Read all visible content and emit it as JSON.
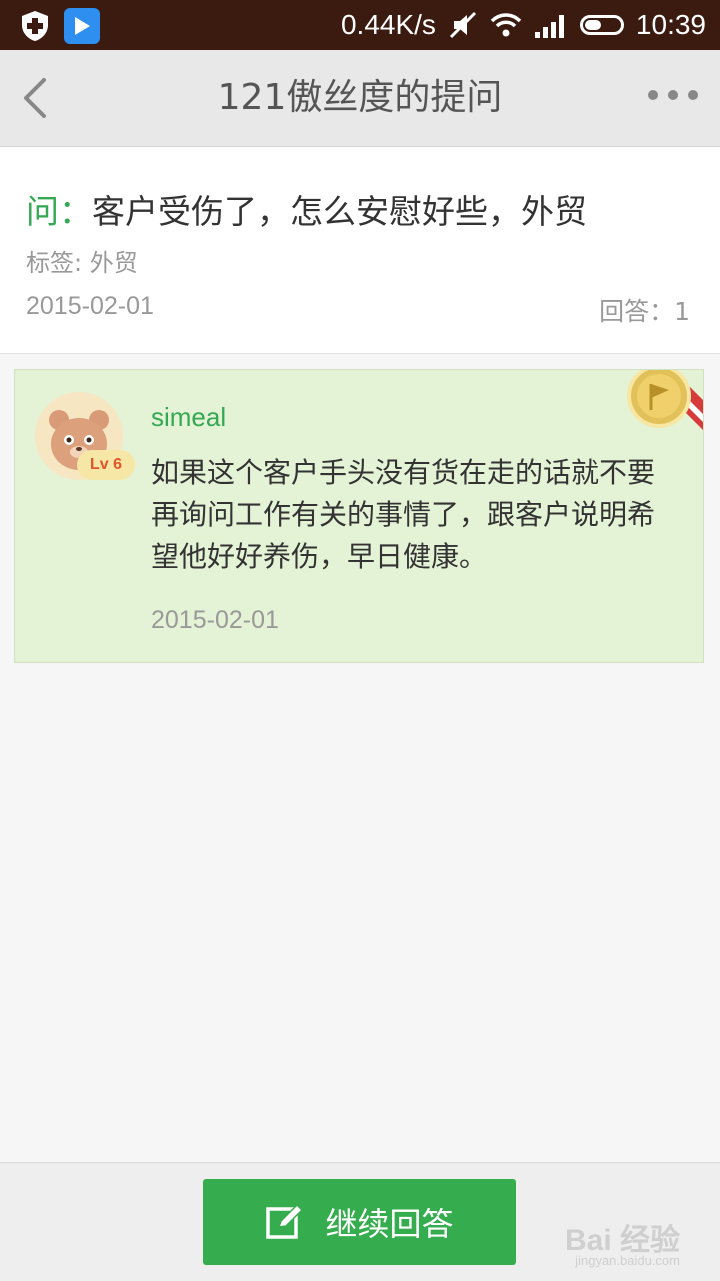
{
  "status_bar": {
    "network_speed": "0.44K/s",
    "time": "10:39",
    "icons": [
      "shield-icon",
      "video-play-icon",
      "mute-icon",
      "wifi-icon",
      "signal-icon",
      "battery-icon"
    ]
  },
  "header": {
    "title": "121傲丝度的提问",
    "back_icon": "chevron-left-icon",
    "more_icon": "more-dots-icon"
  },
  "question": {
    "prefix": "问：",
    "text": "客户受伤了，怎么安慰好些，外贸",
    "tag_label": "标签:",
    "tag_value": "外贸",
    "date": "2015-02-01",
    "answer_count_label": "回答：1"
  },
  "answer": {
    "username": "simeal",
    "level": "Lv 6",
    "text": "如果这个客户手头没有货在走的话就不要再询问工作有关的事情了，跟客户说明希望他好好养伤，早日健康。",
    "date": "2015-02-01",
    "badge_icon": "best-answer-medal-icon"
  },
  "bottom": {
    "button_label": "继续回答",
    "button_icon": "edit-icon",
    "watermark": "Bai 经验",
    "watermark_sub": "jingyan.baidu.com"
  },
  "colors": {
    "accent_green": "#35ad4f",
    "status_bar_bg": "#3b1a10",
    "answer_bg": "#e4f3d6"
  }
}
